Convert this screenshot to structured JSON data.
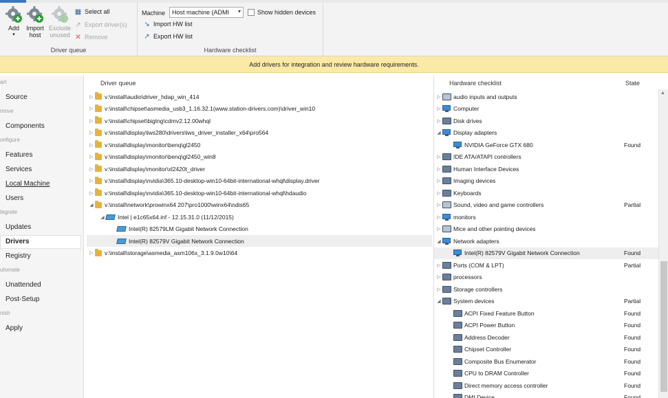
{
  "ribbon": {
    "driver_queue_group": {
      "add_label": "Add",
      "import_host_label": "Import host",
      "exclude_unused_label": "Exclude unused",
      "select_all_label": "Select all",
      "export_drivers_label": "Export driver(s)",
      "remove_label": "Remove",
      "group_label": "Driver queue"
    },
    "hardware_group": {
      "machine_label": "Machine",
      "machine_value": "Host machine (ADMI",
      "show_hidden_label": "Show hidden devices",
      "import_hw_label": "Import HW list",
      "export_hw_label": "Export HW list",
      "group_label": "Hardware checklist"
    }
  },
  "banner": {
    "text": "Add drivers for integration and review hardware requirements."
  },
  "sidebar": {
    "sections": [
      {
        "head": "art",
        "items": [
          "Source"
        ]
      },
      {
        "head": "move",
        "items": [
          "Components"
        ]
      },
      {
        "head": "onfigure",
        "items": [
          "Features",
          "Services",
          "Local Machine",
          "Users"
        ]
      },
      {
        "head": "tegrate",
        "items": [
          "Updates",
          "Drivers",
          "Registry"
        ]
      },
      {
        "head": "utomate",
        "items": [
          "Unattended",
          "Post-Setup"
        ]
      },
      {
        "head": "nish",
        "items": [
          "Apply"
        ]
      }
    ],
    "selected": "Drivers"
  },
  "driver_queue": {
    "header": "Driver queue",
    "rows": [
      {
        "text": "v:\\install\\audio\\driver_hdap_win_414",
        "expander": "▷",
        "type": "folder"
      },
      {
        "text": "v:\\install\\chipset\\asmedia_usb3_1.16.32.1(www.station-drivers.com)\\driver_win10",
        "expander": "▷",
        "type": "folder"
      },
      {
        "text": "v:\\install\\chipset\\bigtng\\cdmv2.12.00whql",
        "expander": "▷",
        "type": "folder"
      },
      {
        "text": "v:\\install\\display\\lws280\\drivers\\lws_driver_installer_x64\\pro564",
        "expander": "▷",
        "type": "folder"
      },
      {
        "text": "v:\\install\\display\\monitor\\benq\\gl2450",
        "expander": "▷",
        "type": "folder"
      },
      {
        "text": "v:\\install\\display\\monitor\\benq\\gl2450_win8",
        "expander": "▷",
        "type": "folder"
      },
      {
        "text": "v:\\install\\display\\monitor\\xl2420t_driver",
        "expander": "▷",
        "type": "folder"
      },
      {
        "text": "v:\\install\\display\\nvidia\\365.10-desktop-win10-64bit-international-whql\\display.driver",
        "expander": "▷",
        "type": "folder"
      },
      {
        "text": "v:\\install\\display\\nvidia\\365.10-desktop-win10-64bit-international-whql\\hdaudio",
        "expander": "▷",
        "type": "folder"
      },
      {
        "text": "v:\\install\\network\\prowinx64 207\\pro1000\\winx64\\ndis65",
        "expander": "◢",
        "type": "folder"
      },
      {
        "text": "Intel | e1c65x64.inf - 12.15.31.0 (11/12/2015)",
        "expander": "◢",
        "type": "inf",
        "indent": 1
      },
      {
        "text": "Intel(R) 82579LM Gigabit Network Connection",
        "expander": "",
        "type": "device",
        "indent": 2
      },
      {
        "text": "Intel(R) 82579V Gigabit Network Connection",
        "expander": "",
        "type": "device",
        "indent": 2,
        "selected": true
      },
      {
        "text": "v:\\install\\storage\\asmedia_asm106x_3.1.9.0w10\\64",
        "expander": "▷",
        "type": "folder"
      }
    ]
  },
  "hardware_checklist": {
    "header": "Hardware checklist",
    "state_header": "State",
    "rows": [
      {
        "text": "audio inputs and outputs",
        "expander": "▷",
        "state": "",
        "indent": 0,
        "icon": "speaker-icon"
      },
      {
        "text": "Computer",
        "expander": "▷",
        "state": "",
        "indent": 0,
        "icon": "monitor-icon"
      },
      {
        "text": "Disk drives",
        "expander": "▷",
        "state": "",
        "indent": 0,
        "icon": "disk-icon"
      },
      {
        "text": "Display adapters",
        "expander": "◢",
        "state": "",
        "indent": 0,
        "icon": "monitor-icon"
      },
      {
        "text": "NVIDIA GeForce GTX 680",
        "expander": "",
        "state": "Found",
        "indent": 1,
        "icon": "monitor-icon"
      },
      {
        "text": "IDE ATA/ATAPI controllers",
        "expander": "▷",
        "state": "",
        "indent": 0,
        "icon": "disk-icon"
      },
      {
        "text": "Human Interface Devices",
        "expander": "▷",
        "state": "",
        "indent": 0,
        "icon": "hid-icon"
      },
      {
        "text": "Imaging devices",
        "expander": "▷",
        "state": "",
        "indent": 0,
        "icon": "camera-icon"
      },
      {
        "text": "Keyboards",
        "expander": "▷",
        "state": "",
        "indent": 0,
        "icon": "keyboard-icon"
      },
      {
        "text": "Sound, video and game controllers",
        "expander": "▷",
        "state": "Partial",
        "indent": 0,
        "icon": "speaker-icon"
      },
      {
        "text": "monitors",
        "expander": "▷",
        "state": "",
        "indent": 0,
        "icon": "monitor-icon"
      },
      {
        "text": "Mice and other pointing devices",
        "expander": "▷",
        "state": "",
        "indent": 0,
        "icon": "mouse-icon"
      },
      {
        "text": "Network adapters",
        "expander": "◢",
        "state": "",
        "indent": 0,
        "icon": "network-icon"
      },
      {
        "text": "Intel(R) 82579V Gigabit Network Connection",
        "expander": "",
        "state": "Found",
        "indent": 1,
        "icon": "network-icon",
        "selected": true
      },
      {
        "text": "Ports (COM & LPT)",
        "expander": "▷",
        "state": "Partial",
        "indent": 0,
        "icon": "port-icon"
      },
      {
        "text": "processors",
        "expander": "▷",
        "state": "",
        "indent": 0,
        "icon": "chip-icon"
      },
      {
        "text": "Storage controllers",
        "expander": "▷",
        "state": "",
        "indent": 0,
        "icon": "storage-icon"
      },
      {
        "text": "System devices",
        "expander": "◢",
        "state": "Partial",
        "indent": 0,
        "icon": "system-icon"
      },
      {
        "text": "ACPI Fixed Feature Button",
        "expander": "",
        "state": "Found",
        "indent": 1,
        "icon": "system-icon"
      },
      {
        "text": "ACPI Power Button",
        "expander": "",
        "state": "Found",
        "indent": 1,
        "icon": "system-icon"
      },
      {
        "text": "Address Decoder",
        "expander": "",
        "state": "Found",
        "indent": 1,
        "icon": "system-icon"
      },
      {
        "text": "Chipset Controller",
        "expander": "",
        "state": "Found",
        "indent": 1,
        "icon": "system-icon"
      },
      {
        "text": "Composite Bus Enumerator",
        "expander": "",
        "state": "Found",
        "indent": 1,
        "icon": "system-icon"
      },
      {
        "text": "CPU to DRAM Controller",
        "expander": "",
        "state": "Found",
        "indent": 1,
        "icon": "system-icon"
      },
      {
        "text": "Direct memory access controller",
        "expander": "",
        "state": "Found",
        "indent": 1,
        "icon": "system-icon"
      },
      {
        "text": "DMI Device",
        "expander": "",
        "state": "Found",
        "indent": 1,
        "icon": "system-icon"
      }
    ]
  },
  "colors": {
    "banner": "#fbe9a6",
    "accent": "#3a78c3",
    "folder": "#e8b23a"
  }
}
